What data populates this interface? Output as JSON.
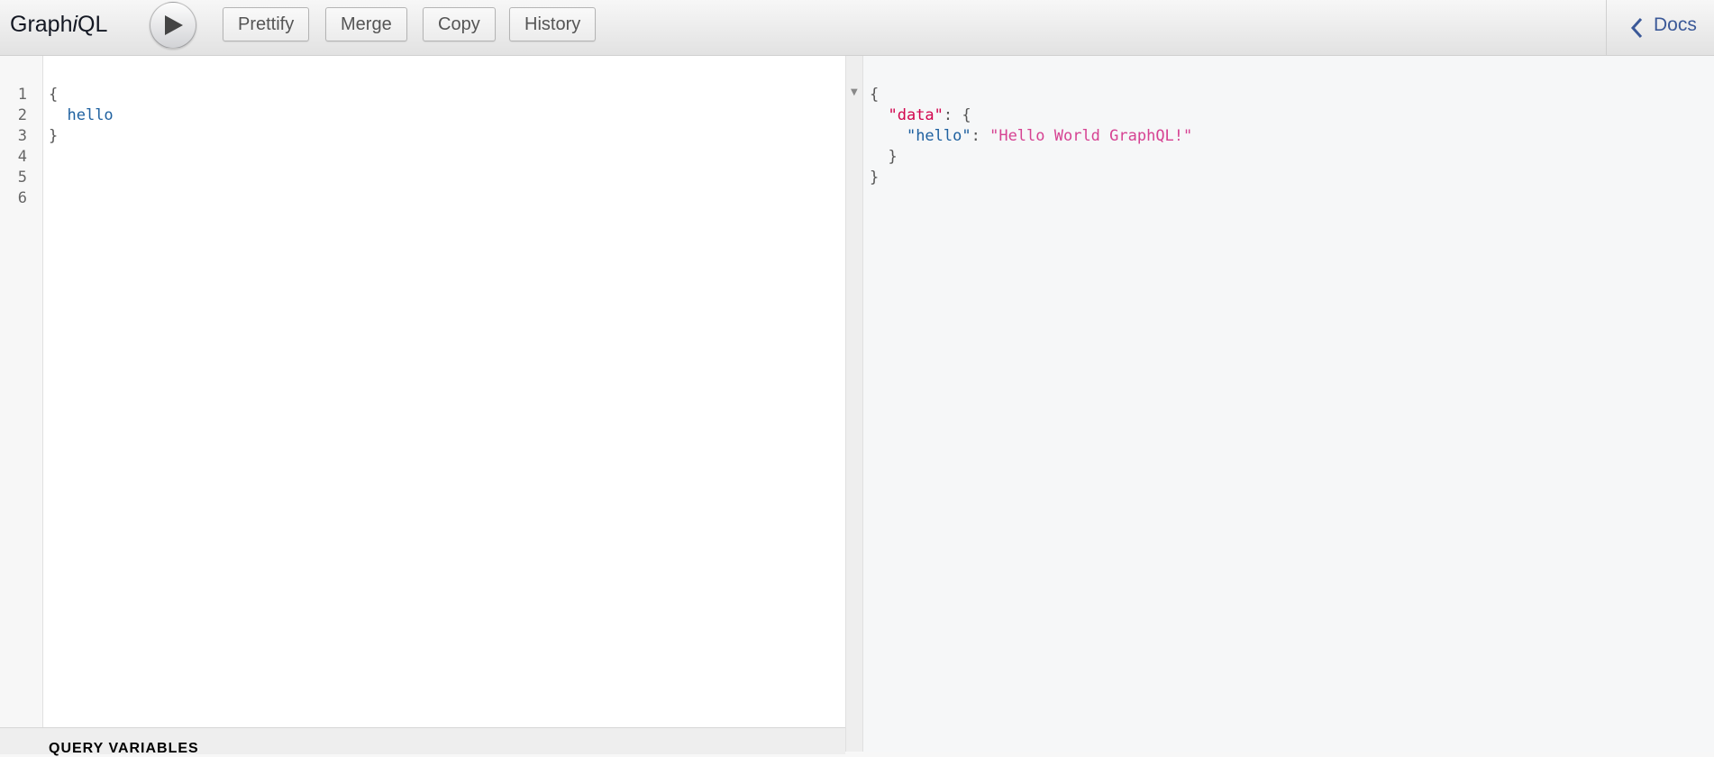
{
  "app": {
    "title_prefix": "Graph",
    "title_italic": "i",
    "title_suffix": "QL"
  },
  "toolbar": {
    "execute_icon": "play-icon",
    "buttons": [
      {
        "label": "Prettify"
      },
      {
        "label": "Merge"
      },
      {
        "label": "Copy"
      },
      {
        "label": "History"
      }
    ],
    "docs": {
      "label": "Docs",
      "icon": "chevron-left-icon"
    }
  },
  "query_editor": {
    "line_numbers": [
      "1",
      "2",
      "3",
      "4",
      "5",
      "6"
    ],
    "lines": [
      {
        "text": "{"
      },
      {
        "indent": "  ",
        "field": "hello"
      },
      {
        "text": "}"
      }
    ]
  },
  "variables_bar": {
    "label": "QUERY VARIABLES"
  },
  "result": {
    "fold_icon": "fold-arrow-icon",
    "open_brace": "{",
    "data_key": "\"data\"",
    "colon": ": ",
    "data_open": "{",
    "hello_key": "\"hello\"",
    "hello_value": "\"Hello World GraphQL!\"",
    "data_close": "}",
    "close_brace": "}"
  },
  "colors": {
    "link": "#3b5998",
    "field": "#1f61a0",
    "def_key": "#d2054e",
    "string": "#d64292"
  }
}
